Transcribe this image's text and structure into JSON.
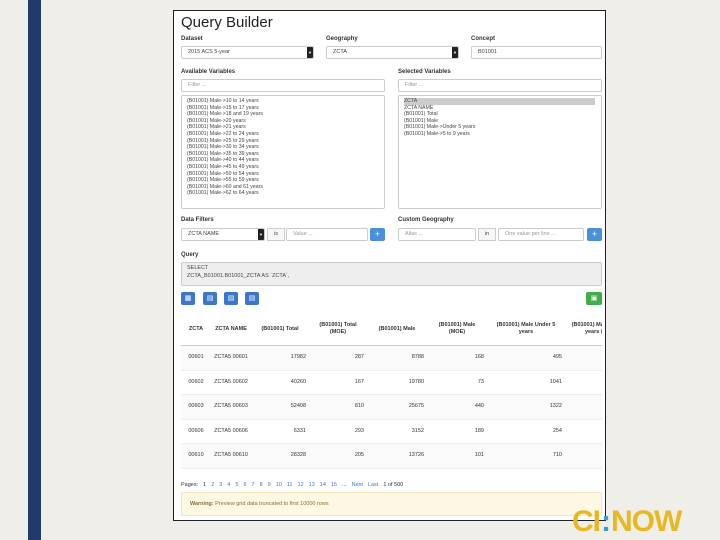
{
  "title": "Query Builder",
  "dataset": {
    "label": "Dataset",
    "value": "2015 ACS 5-year"
  },
  "geography": {
    "label": "Geography",
    "value": "ZCTA"
  },
  "concept": {
    "label": "Concept",
    "value": "B01001"
  },
  "available": {
    "label": "Available Variables",
    "filter_placeholder": "Filter ...",
    "items": [
      "(B01001) Male->10 to 14 years",
      "(B01001) Male->15 to 17 years",
      "(B01001) Male->18 and 19 years",
      "(B01001) Male->20 years",
      "(B01001) Male->21 years",
      "(B01001) Male->22 to 24 years",
      "(B01001) Male->25 to 29 years",
      "(B01001) Male->30 to 34 years",
      "(B01001) Male->35 to 39 years",
      "(B01001) Male->40 to 44 years",
      "(B01001) Male->45 to 49 years",
      "(B01001) Male->50 to 54 years",
      "(B01001) Male->55 to 59 years",
      "(B01001) Male->60 and 61 years",
      "(B01001) Male->62 to 64 years"
    ]
  },
  "selected": {
    "label": "Selected Variables",
    "filter_placeholder": "Filter ...",
    "items": [
      "ZCTA",
      "ZCTA NAME",
      "(B01001) Total",
      "(B01001) Male",
      "(B01001) Male->Under 5 years",
      "(B01001) Male->5 to 9 years"
    ]
  },
  "data_filters": {
    "label": "Data Filters",
    "field": "ZCTA NAME",
    "op": "is",
    "value_placeholder": "Value ...",
    "add": "+"
  },
  "custom_geo": {
    "label": "Custom Geography",
    "alias_placeholder": "Alias ...",
    "op": "in",
    "values_placeholder": "One value per line ...",
    "add": "+"
  },
  "query": {
    "label": "Query",
    "line1": "SELECT",
    "line2": "ZCTA_B01001.B01001_ZCTA AS `ZCTA`,"
  },
  "icons": {
    "table": "▦",
    "doc": "▤",
    "save": "▣",
    "add": "+"
  },
  "table": {
    "headers": [
      "ZCTA",
      "ZCTA NAME",
      "(B01001) Total",
      "(B01001) Total (MOE)",
      "(B01001) Male",
      "(B01001) Male (MOE)",
      "(B01001) Male Under 5 years",
      "(B01001) Male Under 5 years (MOE)",
      "(B0"
    ],
    "rows": [
      [
        "00601",
        "ZCTA5 00601",
        "17982",
        "287",
        "8788",
        "168",
        "495",
        "39",
        ""
      ],
      [
        "00602",
        "ZCTA5 00602",
        "40260",
        "167",
        "19780",
        "73",
        "1041",
        "2",
        ""
      ],
      [
        "00603",
        "ZCTA5 00603",
        "52408",
        "810",
        "25675",
        "440",
        "1322",
        "111",
        ""
      ],
      [
        "00606",
        "ZCTA5 00606",
        "6331",
        "293",
        "3152",
        "189",
        "254",
        "71",
        ""
      ],
      [
        "00610",
        "ZCTA5 00610",
        "28328",
        "205",
        "13726",
        "101",
        "710",
        "25",
        ""
      ]
    ]
  },
  "pager": {
    "label": "Pages:",
    "pages": [
      "1",
      "2",
      "3",
      "4",
      "5",
      "6",
      "7",
      "8",
      "9",
      "10",
      "11",
      "12",
      "13",
      "14",
      "15"
    ],
    "ellipsis": "...",
    "next": "Next",
    "last": "Last",
    "of": "1 of 500"
  },
  "warning": {
    "bold": "Warning:",
    "text": " Preview grid data truncated to first 10000 rows"
  },
  "logo": {
    "part1": "CI",
    "colon": ":",
    "part2": "NOW"
  }
}
